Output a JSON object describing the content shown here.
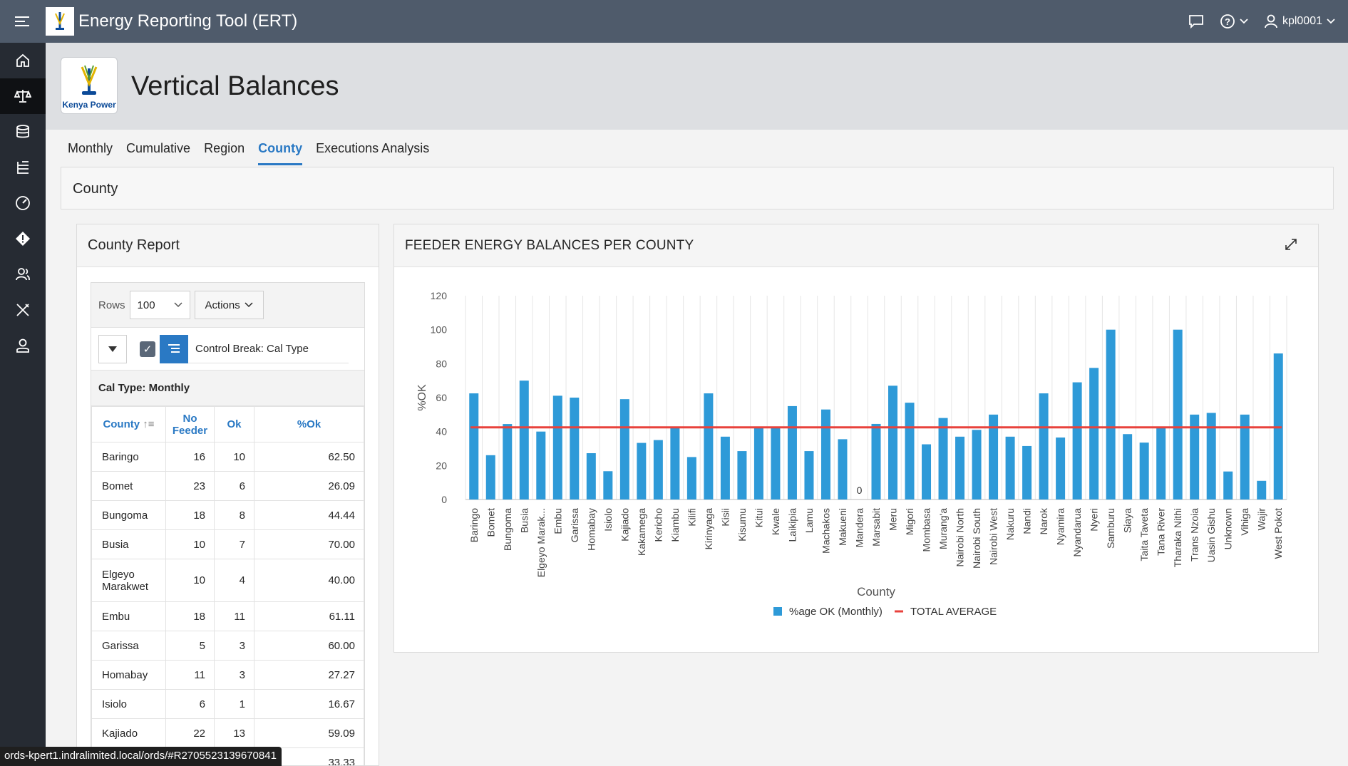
{
  "header": {
    "app_title": "Energy Reporting Tool (ERT)",
    "user": "kpl0001"
  },
  "sidebar": {
    "items": [
      "home-icon",
      "balance-scale-icon",
      "database-icon",
      "tree-list-icon",
      "gauge-icon",
      "warning-diamond-icon",
      "users-icon",
      "tools-icon",
      "admin-user-icon"
    ]
  },
  "page": {
    "title": "Vertical Balances",
    "logo_text": "Kenya Power"
  },
  "tabs": [
    {
      "label": "Monthly",
      "active": false
    },
    {
      "label": "Cumulative",
      "active": false
    },
    {
      "label": "Region",
      "active": false
    },
    {
      "label": "County",
      "active": true
    },
    {
      "label": "Executions Analysis",
      "active": false
    }
  ],
  "region_title": "County",
  "report": {
    "title": "County Report",
    "rows_label": "Rows",
    "rows_value": "100",
    "actions_label": "Actions",
    "control_break_label": "Control Break: Cal Type",
    "break_header": "Cal Type: Monthly",
    "columns": [
      "County",
      "No Feeder",
      "Ok",
      "%Ok"
    ],
    "rows": [
      {
        "county": "Baringo",
        "no_feeder": "16",
        "ok": "10",
        "pct": "62.50"
      },
      {
        "county": "Bomet",
        "no_feeder": "23",
        "ok": "6",
        "pct": "26.09"
      },
      {
        "county": "Bungoma",
        "no_feeder": "18",
        "ok": "8",
        "pct": "44.44"
      },
      {
        "county": "Busia",
        "no_feeder": "10",
        "ok": "7",
        "pct": "70.00"
      },
      {
        "county": "Elgeyo Marakwet",
        "no_feeder": "10",
        "ok": "4",
        "pct": "40.00"
      },
      {
        "county": "Embu",
        "no_feeder": "18",
        "ok": "11",
        "pct": "61.11"
      },
      {
        "county": "Garissa",
        "no_feeder": "5",
        "ok": "3",
        "pct": "60.00"
      },
      {
        "county": "Homabay",
        "no_feeder": "11",
        "ok": "3",
        "pct": "27.27"
      },
      {
        "county": "Isiolo",
        "no_feeder": "6",
        "ok": "1",
        "pct": "16.67"
      },
      {
        "county": "Kajiado",
        "no_feeder": "22",
        "ok": "13",
        "pct": "59.09"
      },
      {
        "county": "",
        "no_feeder": "",
        "ok": "",
        "pct": "33.33"
      }
    ]
  },
  "chart_panel": {
    "title": "FEEDER ENERGY BALANCES PER COUNTY"
  },
  "chart_data": {
    "type": "bar",
    "title": "FEEDER ENERGY BALANCES PER COUNTY",
    "xlabel": "County",
    "ylabel": "%OK",
    "ylim": [
      0,
      120
    ],
    "yticks": [
      0,
      20,
      40,
      60,
      80,
      100,
      120
    ],
    "grid": true,
    "legend_position": "bottom",
    "categories": [
      "Baringo",
      "Bomet",
      "Bungoma",
      "Busia",
      "Elgeyo Marak...",
      "Embu",
      "Garissa",
      "Homabay",
      "Isiolo",
      "Kajiado",
      "Kakamega",
      "Kericho",
      "Kiambu",
      "Kilifi",
      "Kirinyaga",
      "Kisii",
      "Kisumu",
      "Kitui",
      "Kwale",
      "Laikipia",
      "Lamu",
      "Machakos",
      "Makueni",
      "Mandera",
      "Marsabit",
      "Meru",
      "Migori",
      "Mombasa",
      "Murang'a",
      "Nairobi North",
      "Nairobi South",
      "Nairobi West",
      "Nakuru",
      "Nandi",
      "Narok",
      "Nyamira",
      "Nyandarua",
      "Nyeri",
      "Samburu",
      "Siaya",
      "Taita Taveta",
      "Tana River",
      "Tharaka Nithi",
      "Trans Nzoia",
      "Uasin Gishu",
      "Unknown",
      "Vihiga",
      "Wajir",
      "West Pokot"
    ],
    "series": [
      {
        "name": "%age OK (Monthly)",
        "type": "bar",
        "color": "#2e9ad8",
        "values": [
          62.5,
          26.09,
          44.44,
          70,
          40,
          61.11,
          60,
          27.27,
          16.67,
          59.09,
          33.33,
          35,
          42,
          25,
          62.5,
          37,
          28.5,
          42.5,
          42,
          55,
          28.5,
          53,
          35.5,
          0,
          44.5,
          67,
          57,
          32.5,
          48,
          37,
          41,
          50,
          37,
          31.5,
          62.5,
          36.5,
          69,
          77.5,
          100,
          38.5,
          33.5,
          42.5,
          100,
          50,
          51,
          16.5,
          50,
          11,
          86
        ]
      },
      {
        "name": "TOTAL AVERAGE",
        "type": "line",
        "color": "#e8423c",
        "values": [
          42.5
        ]
      }
    ],
    "annotations": [
      "0"
    ]
  },
  "status_url": "ords-kpert1.indralimited.local/ords/#R2705523139670841"
}
